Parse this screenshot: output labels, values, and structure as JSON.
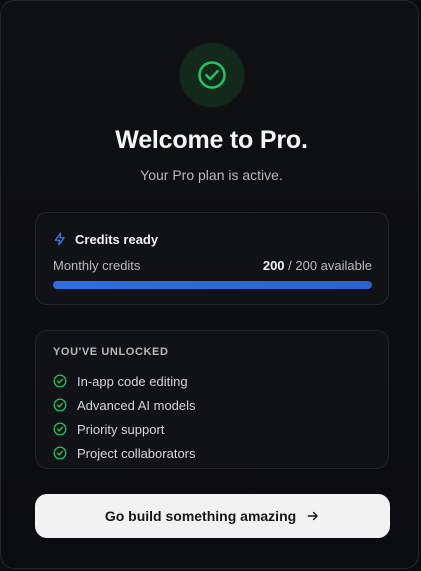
{
  "header": {
    "title": "Welcome to Pro.",
    "subtitle": "Your Pro plan is active."
  },
  "credits": {
    "title": "Credits ready",
    "label": "Monthly credits",
    "current": "200",
    "total_text": " / 200 available",
    "progress_fraction": 1.0
  },
  "unlocked": {
    "heading": "YOU'VE UNLOCKED",
    "items": [
      {
        "label": "In-app code editing"
      },
      {
        "label": "Advanced AI models"
      },
      {
        "label": "Priority support"
      },
      {
        "label": "Project collaborators"
      }
    ]
  },
  "cta": {
    "label": "Go build something amazing"
  },
  "icons": {
    "badge": "check-circle-icon",
    "credits": "lightning-icon",
    "feature": "check-circle-icon",
    "cta": "arrow-right-icon"
  },
  "colors": {
    "success": "#22c55e",
    "accent": "#2f6fe0",
    "cta_bg": "#f2f2f3"
  }
}
